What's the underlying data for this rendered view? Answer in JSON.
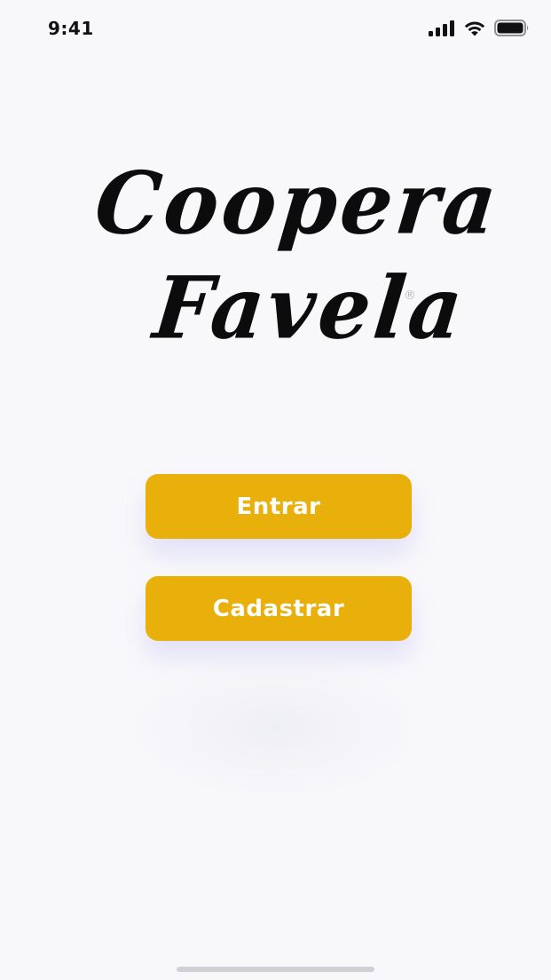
{
  "status_bar": {
    "time": "9:41",
    "icons": [
      "cellular-signal-icon",
      "wifi-icon",
      "battery-icon"
    ]
  },
  "logo": {
    "line1": "Coopera",
    "line2": "Favela",
    "registered_mark": "®"
  },
  "actions": {
    "enter_label": "Entrar",
    "register_label": "Cadastrar"
  },
  "colors": {
    "button_background": "#e9b00b",
    "button_text": "#ffffff",
    "background": "#f8f8fb",
    "logo_text": "#0c0c0c"
  }
}
